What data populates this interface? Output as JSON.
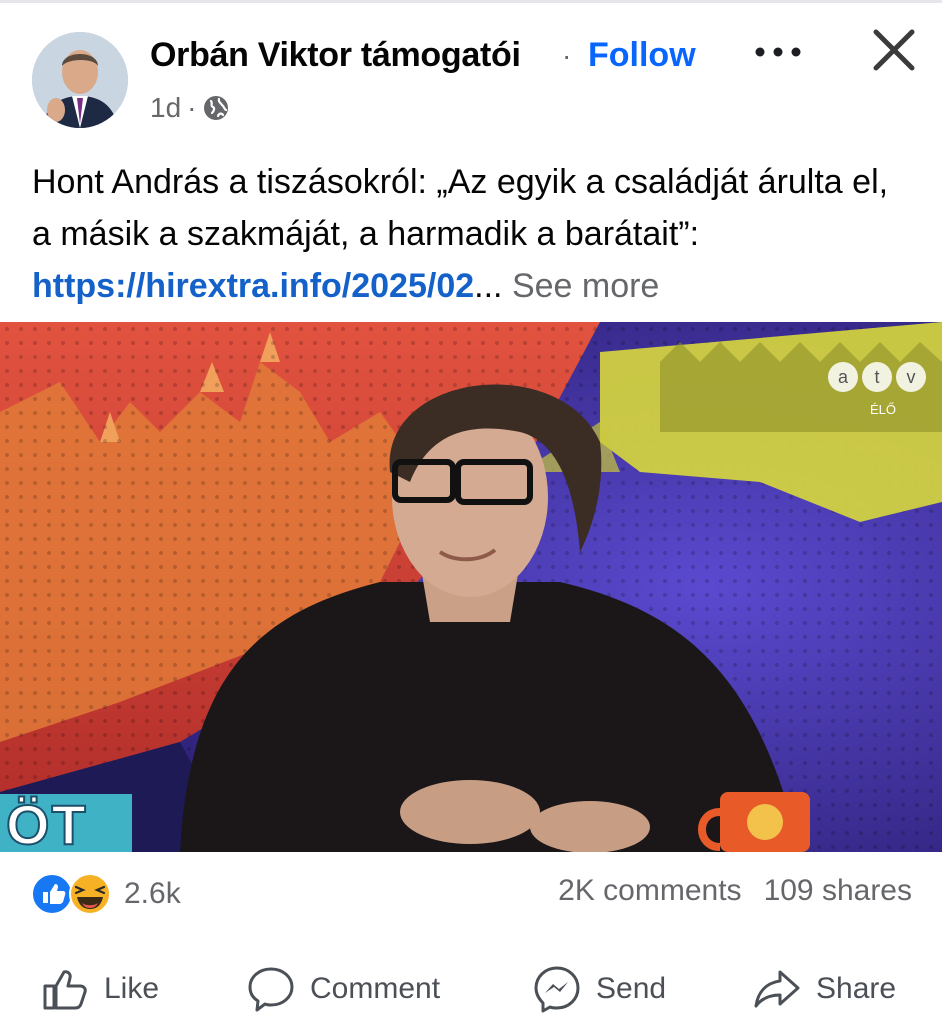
{
  "header": {
    "page_name": "Orbán Viktor támogatói",
    "separator": "·",
    "follow_label": "Follow",
    "time": "1d",
    "meta_separator": "·",
    "privacy_icon": "globe-icon",
    "more_icon": "more-dots-icon",
    "close_icon": "close-icon"
  },
  "post": {
    "text_main": "Hont András a tiszásokról: „Az egyik a családját árulta el, a másik a szakmáját, a harmadik a barátait”: ",
    "link_text": "https://hirextra.info/2025/02",
    "ellipsis": "...",
    "see_more": "See more"
  },
  "media": {
    "channel_logo": [
      "a",
      "t",
      "v"
    ],
    "live_label": "ÉLŐ",
    "corner_text": "ÖT"
  },
  "stats": {
    "reaction_icons": [
      "like-icon",
      "haha-icon"
    ],
    "reaction_count": "2.6k",
    "comments": "2K comments",
    "shares": "109 shares"
  },
  "actions": {
    "like": "Like",
    "comment": "Comment",
    "send": "Send",
    "share": "Share"
  },
  "colors": {
    "accent": "#0866ff",
    "link": "#1461c9",
    "muted": "#65676b"
  }
}
